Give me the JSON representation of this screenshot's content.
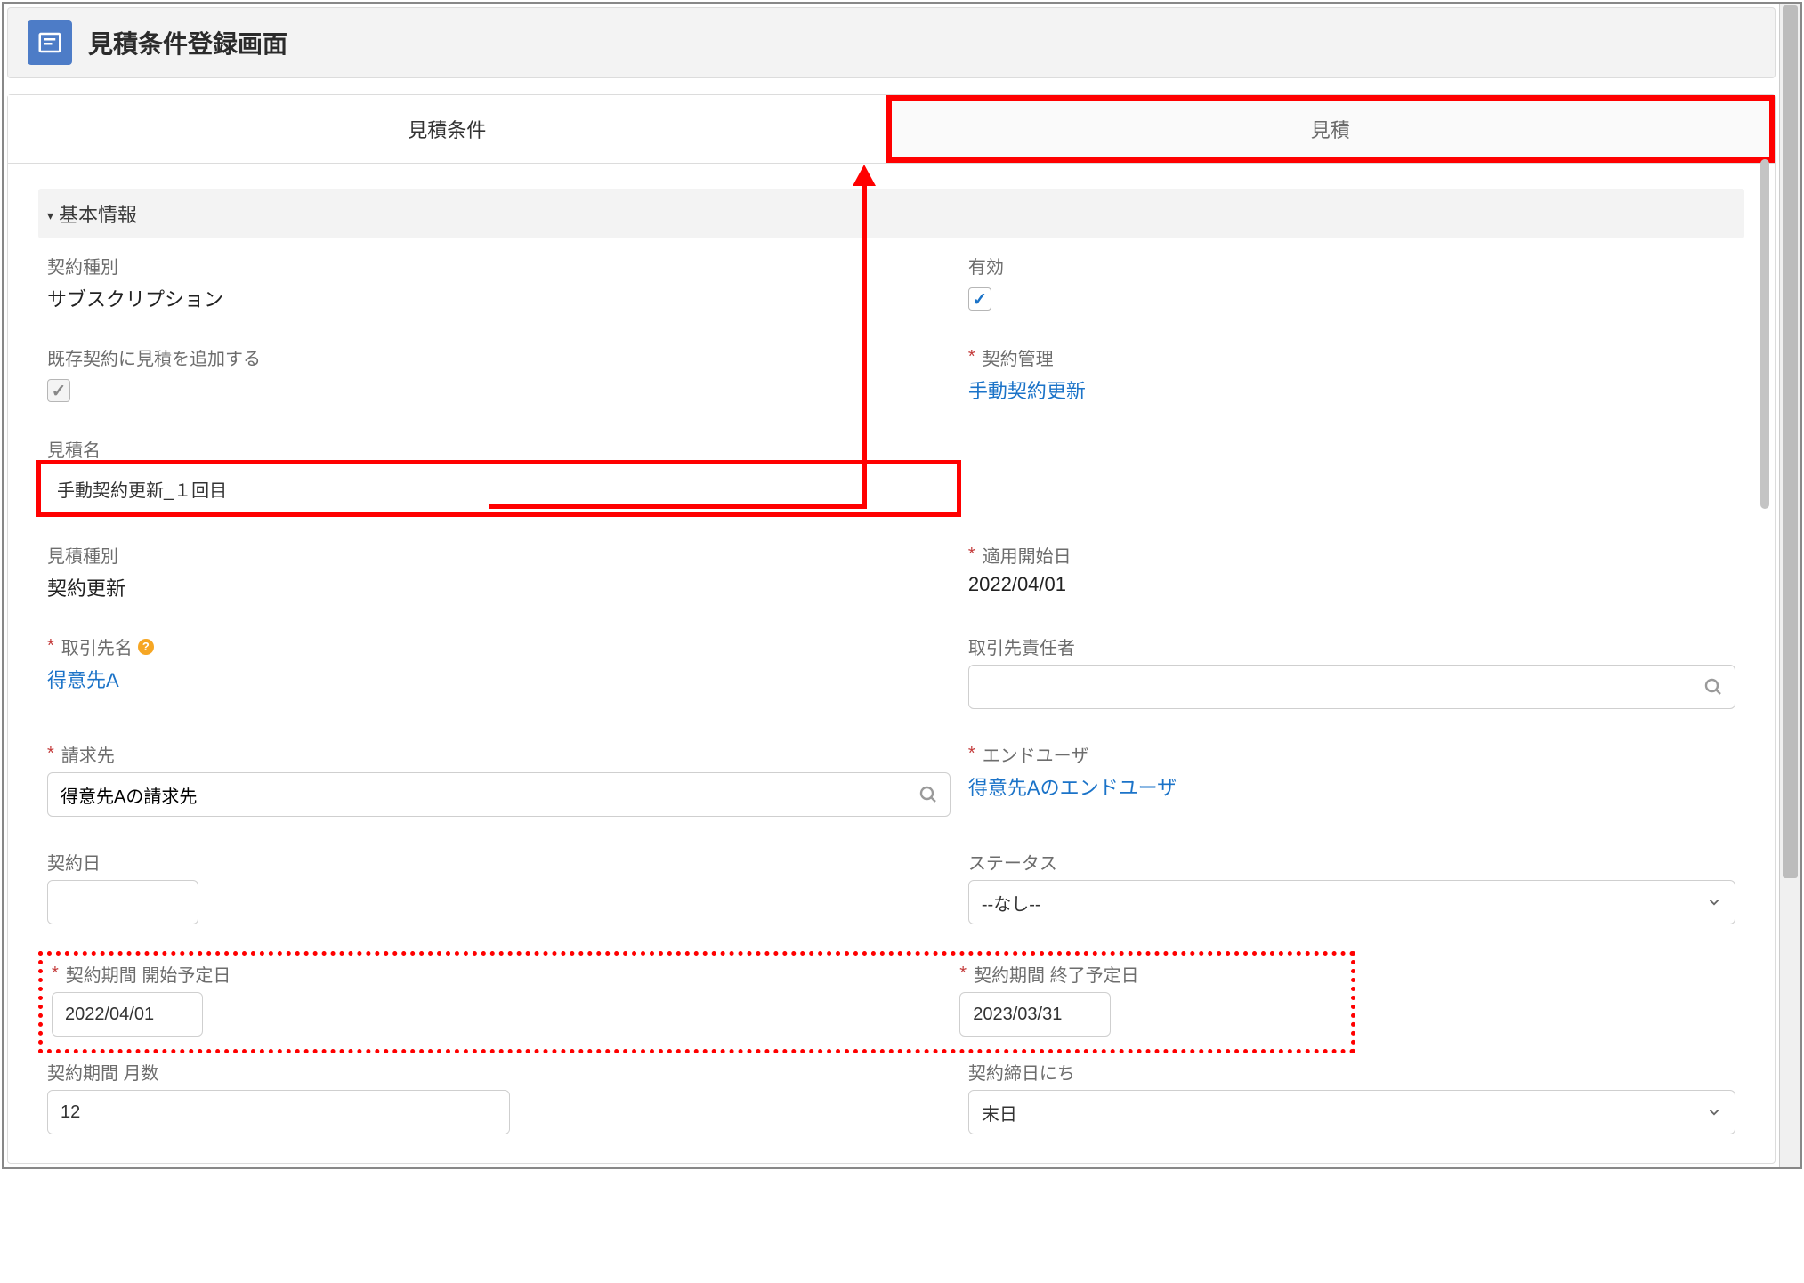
{
  "header": {
    "title": "見積条件登録画面"
  },
  "tabs": {
    "active": "見積条件",
    "inactive": "見積"
  },
  "section": {
    "basic": "基本情報"
  },
  "fields": {
    "contractType": {
      "label": "契約種別",
      "value": "サブスクリプション"
    },
    "valid": {
      "label": "有効"
    },
    "addQuoteToExisting": {
      "label": "既存契約に見積を追加する"
    },
    "contractMgmt": {
      "label": "契約管理",
      "value": "手動契約更新"
    },
    "quoteName": {
      "label": "見積名",
      "value": "手動契約更新_１回目"
    },
    "quoteType": {
      "label": "見積種別",
      "value": "契約更新"
    },
    "applyStart": {
      "label": "適用開始日",
      "value": "2022/04/01"
    },
    "accountName": {
      "label": "取引先名",
      "value": "得意先A"
    },
    "accountOwner": {
      "label": "取引先責任者",
      "placeholder": ""
    },
    "billTo": {
      "label": "請求先",
      "value": "得意先Aの請求先"
    },
    "endUser": {
      "label": "エンドユーザ",
      "value": "得意先Aのエンドユーザ"
    },
    "contractDate": {
      "label": "契約日",
      "value": ""
    },
    "status": {
      "label": "ステータス",
      "value": "--なし--"
    },
    "periodStart": {
      "label": "契約期間 開始予定日",
      "value": "2022/04/01"
    },
    "periodEnd": {
      "label": "契約期間 終了予定日",
      "value": "2023/03/31"
    },
    "periodMonths": {
      "label": "契約期間 月数",
      "value": "12"
    },
    "closingDay": {
      "label": "契約締日にち",
      "value": "末日"
    }
  }
}
